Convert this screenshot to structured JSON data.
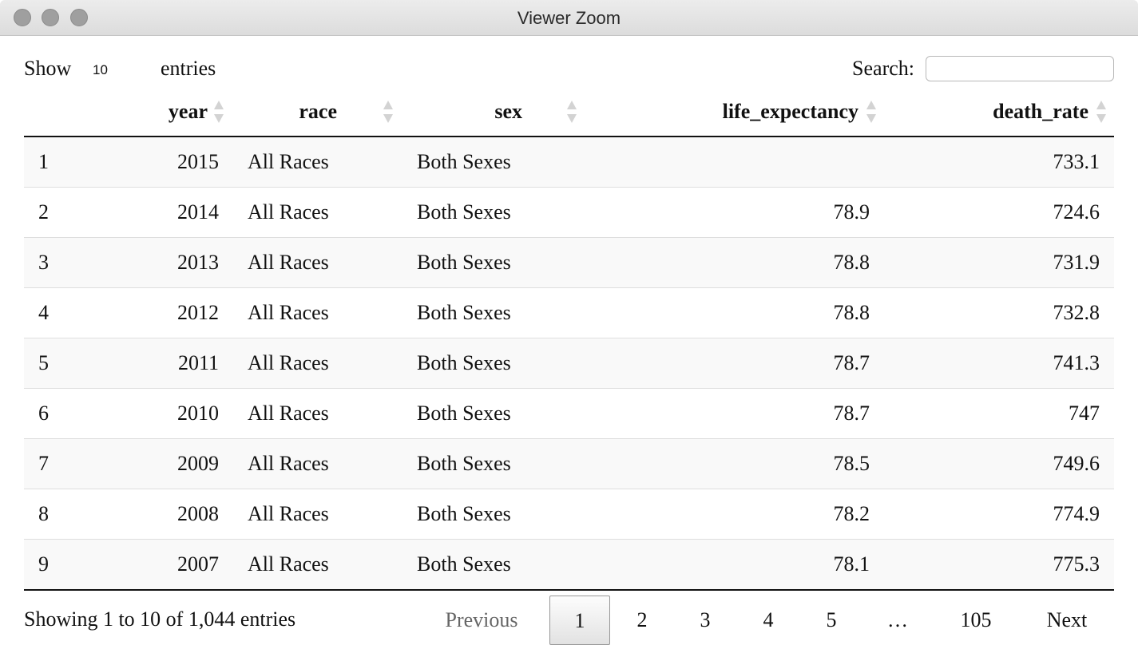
{
  "window": {
    "title": "Viewer Zoom"
  },
  "length_menu": {
    "label_before": "Show",
    "selected": "10",
    "label_after": "entries"
  },
  "search": {
    "label": "Search:",
    "value": "",
    "placeholder": ""
  },
  "table": {
    "columns": [
      "",
      "year",
      "race",
      "sex",
      "life_expectancy",
      "death_rate"
    ],
    "rows": [
      [
        "1",
        "2015",
        "All Races",
        "Both Sexes",
        "",
        "733.1"
      ],
      [
        "2",
        "2014",
        "All Races",
        "Both Sexes",
        "78.9",
        "724.6"
      ],
      [
        "3",
        "2013",
        "All Races",
        "Both Sexes",
        "78.8",
        "731.9"
      ],
      [
        "4",
        "2012",
        "All Races",
        "Both Sexes",
        "78.8",
        "732.8"
      ],
      [
        "5",
        "2011",
        "All Races",
        "Both Sexes",
        "78.7",
        "741.3"
      ],
      [
        "6",
        "2010",
        "All Races",
        "Both Sexes",
        "78.7",
        "747"
      ],
      [
        "7",
        "2009",
        "All Races",
        "Both Sexes",
        "78.5",
        "749.6"
      ],
      [
        "8",
        "2008",
        "All Races",
        "Both Sexes",
        "78.2",
        "774.9"
      ],
      [
        "9",
        "2007",
        "All Races",
        "Both Sexes",
        "78.1",
        "775.3"
      ]
    ]
  },
  "footer": {
    "info": "Showing 1 to 10 of 1,044 entries",
    "pagination": {
      "previous": "Previous",
      "pages": [
        "1",
        "2",
        "3",
        "4",
        "5",
        "…",
        "105"
      ],
      "current": "1",
      "next": "Next"
    }
  },
  "colors": {
    "header_rule": "#111111",
    "stripe": "#f9f9f9",
    "row_rule": "#dedede"
  }
}
